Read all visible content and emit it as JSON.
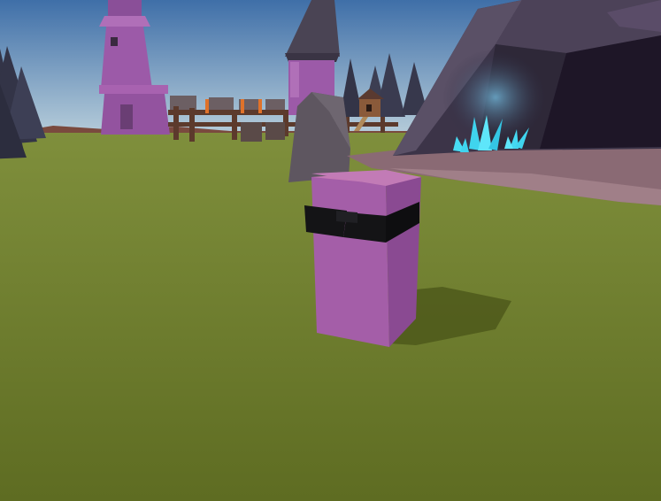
{
  "scene": {
    "view": "third-person",
    "colors": {
      "sky_top": "#3f6fa8",
      "sky_bottom": "#b4cbd9",
      "grass_far": "#7f8f3c",
      "grass_near": "#5e6c22",
      "player_body": "#a45ea8",
      "player_top": "#c47ab4",
      "sunglasses": "#141416",
      "tower_purple": "#9c5aa8",
      "tower_roof": "#4a4454",
      "cave_rock": "#3c3448",
      "cave_inside": "#1e1627",
      "crystal": "#3fd4ee",
      "fence_wood": "#5c3a2c",
      "pine_dark": "#333447"
    }
  }
}
